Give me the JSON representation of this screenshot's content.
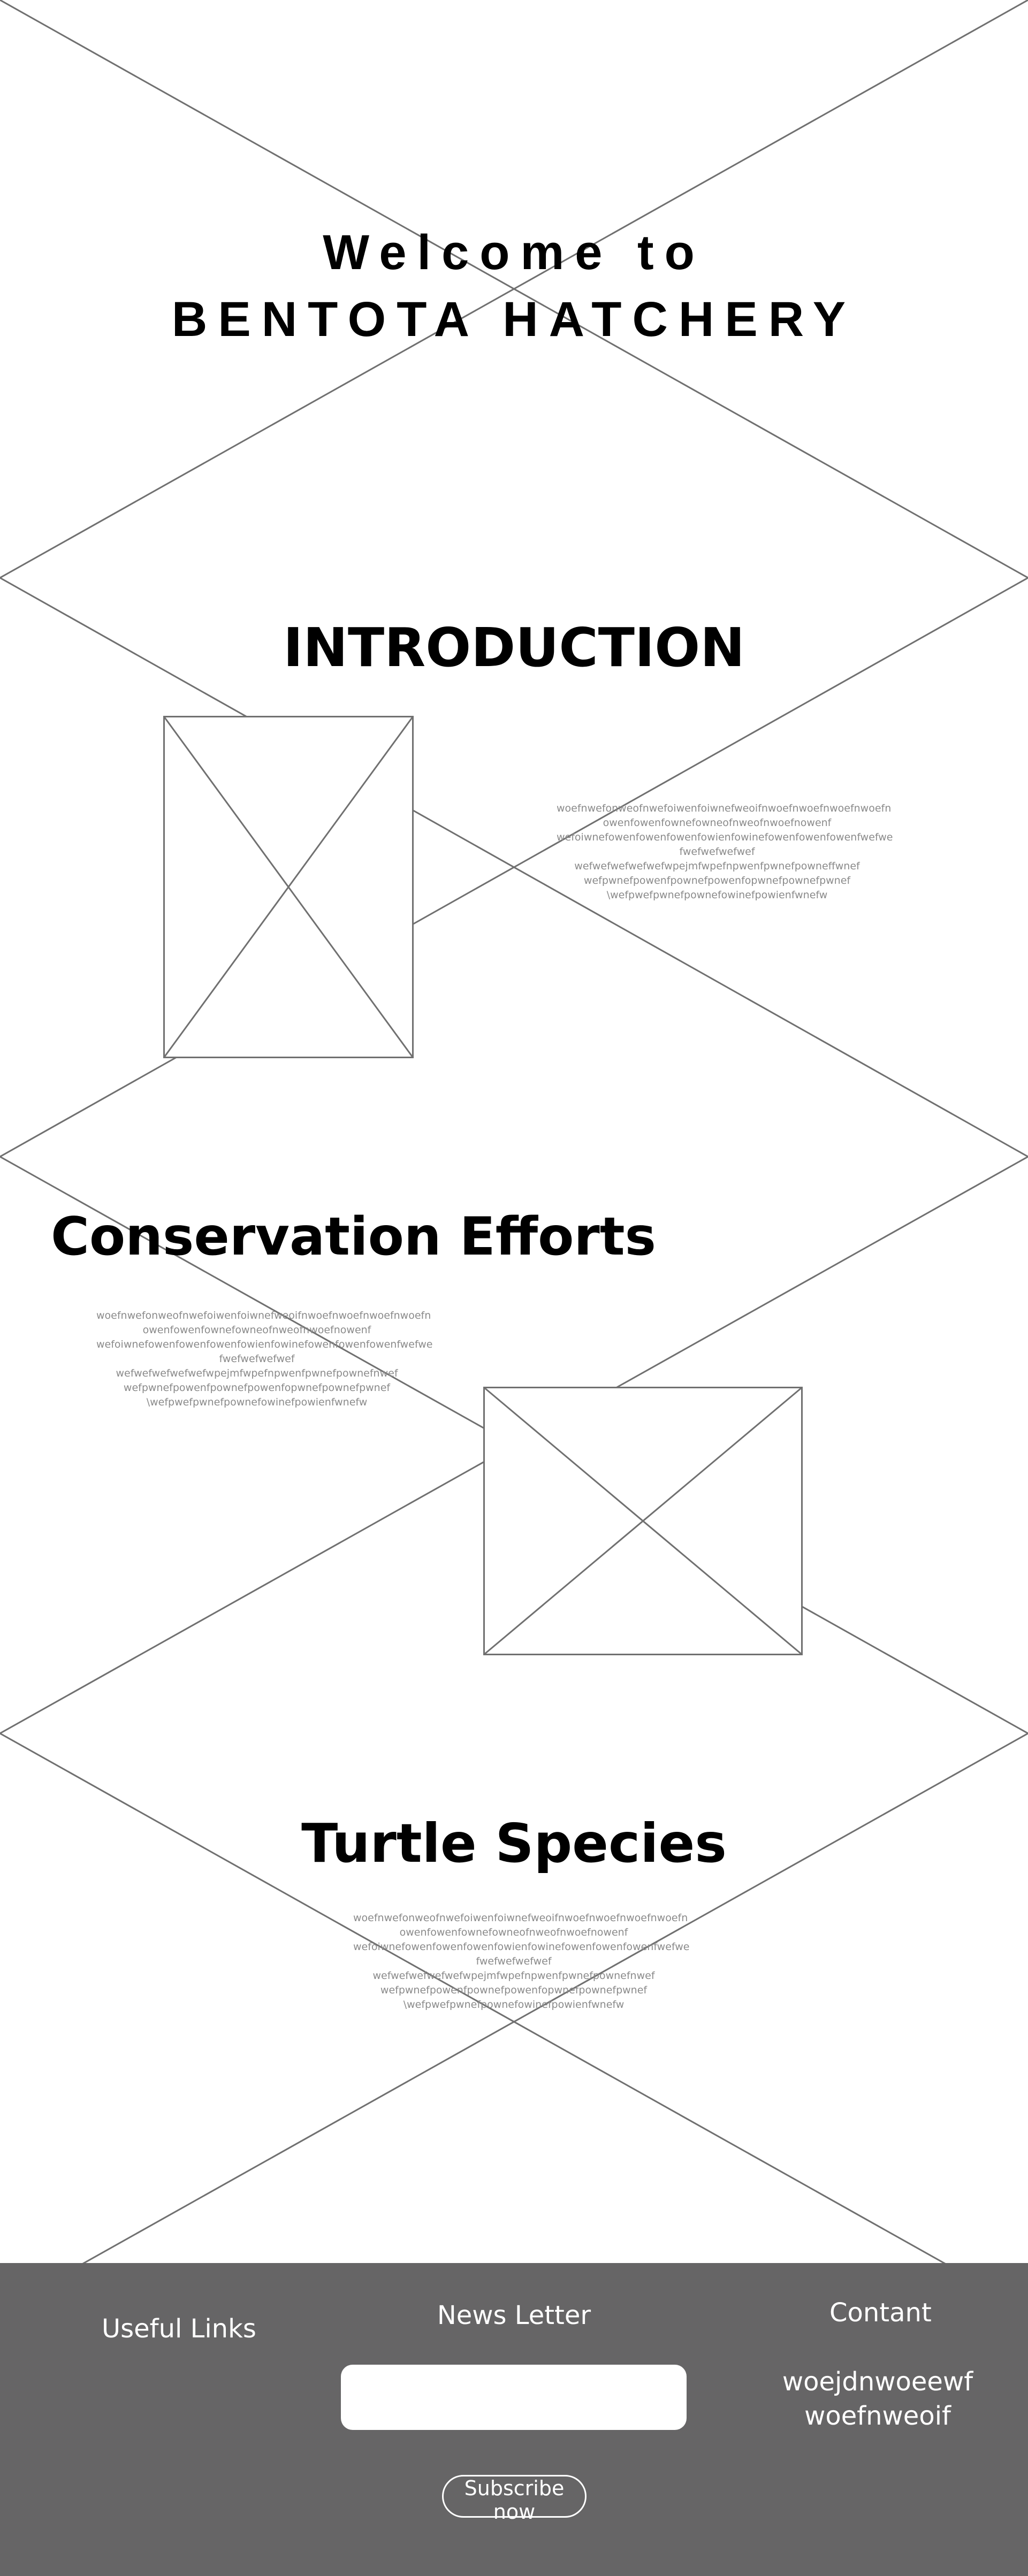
{
  "hero": {
    "line1": "Welcome to",
    "line2": "BENTOTA HATCHERY"
  },
  "introduction": {
    "title": "INTRODUCTION",
    "body": "woefnwefonweofnwefoiwenfoiwnefweoifnwoefnwoefnwoefnwoefn\nowenfowenfownefowneofnweofnwoefnowenf\nwefoiwnefowenfowenfowenfowienfowinefowenfowenfowenfwefwe\nfwefwefwefwef\nwefwefwefwefwefwpejmfwpefnpwenfpwnefpowneffwnef\nwefpwnefpowenfpownefpowenfopwnefpownefpwnef\n\\wefpwefpwnefpownefowinefpowienfwnefw"
  },
  "conservation": {
    "title": "Conservation Efforts",
    "body": "woefnwefonweofnwefoiwenfoiwnefweoifnwoefnwoefnwoefnwoefn\nowenfowenfownefowneofnweofnwoefnowenf\nwefoiwnefowenfowenfowenfowienfowinefowenfowenfowenfwefwe\nfwefwefwefwef\nwefwefwefwefwefwpejmfwpefnpwenfpwnefpownefnwef\nwefpwnefpowenfpownefpowenfopwnefpownefpwnef\n\\wefpwefpwnefpownefowinefpowienfwnefw"
  },
  "species": {
    "title": "Turtle Species",
    "body": "woefnwefonweofnwefoiwenfoiwnefweoifnwoefnwoefnwoefnwoefn\nowenfowenfownefowneofnweofnwoefnowenf\nwefoiwnefowenfowenfowenfowienfowinefowenfowenfowenfwefwe\nfwefwefwefwef\nwefwefwefwefwefwpejmfwpefnpwenfpwnefpownefnwef\nwefpwnefpowenfpownefpowenfopwnefpownefpwnef\n\\wefpwefpwnefpownefowinefpowienfwnefw"
  },
  "footer": {
    "useful_links": "Useful Links",
    "newsletter": "News Letter",
    "email_placeholder": "",
    "subscribe": "Subscribe now",
    "contact": "Contant",
    "contact_text": "woejdnwoeewf\nwoefnweoif"
  },
  "colors": {
    "footer_bg": "#666566",
    "wireframe_line": "#707070",
    "placeholder_text": "#8a8a8a"
  },
  "icons": [
    "image-placeholder-icon",
    "background-placeholder-icon"
  ]
}
